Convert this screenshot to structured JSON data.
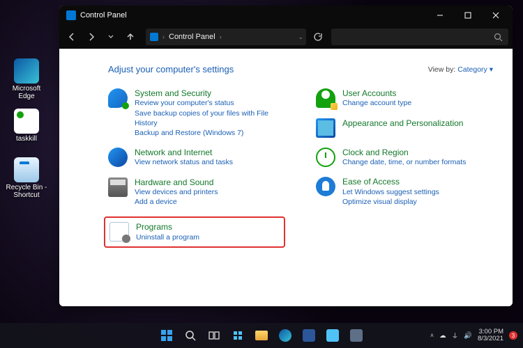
{
  "desktop": {
    "icons": [
      {
        "name": "Microsoft Edge"
      },
      {
        "name": "taskkill"
      },
      {
        "name": "Recycle Bin - Shortcut"
      }
    ]
  },
  "window": {
    "title": "Control Panel",
    "breadcrumb_root": "Control Panel",
    "heading": "Adjust your computer's settings",
    "viewby_label": "View by:",
    "viewby_value": "Category",
    "left": [
      {
        "key": "sec",
        "title": "System and Security",
        "links": [
          "Review your computer's status",
          "Save backup copies of your files with File History",
          "Backup and Restore (Windows 7)"
        ]
      },
      {
        "key": "net",
        "title": "Network and Internet",
        "links": [
          "View network status and tasks"
        ]
      },
      {
        "key": "hw",
        "title": "Hardware and Sound",
        "links": [
          "View devices and printers",
          "Add a device"
        ]
      },
      {
        "key": "prog",
        "title": "Programs",
        "links": [
          "Uninstall a program"
        ],
        "highlighted": true
      }
    ],
    "right": [
      {
        "key": "usr",
        "title": "User Accounts",
        "links": [
          "Change account type"
        ],
        "shield": true
      },
      {
        "key": "ap",
        "title": "Appearance and Personalization",
        "links": []
      },
      {
        "key": "clk",
        "title": "Clock and Region",
        "links": [
          "Change date, time, or number formats"
        ]
      },
      {
        "key": "ea",
        "title": "Ease of Access",
        "links": [
          "Let Windows suggest settings",
          "Optimize visual display"
        ]
      }
    ]
  },
  "taskbar": {
    "time": "3:00 PM",
    "date": "8/3/2021",
    "badge": "3"
  }
}
